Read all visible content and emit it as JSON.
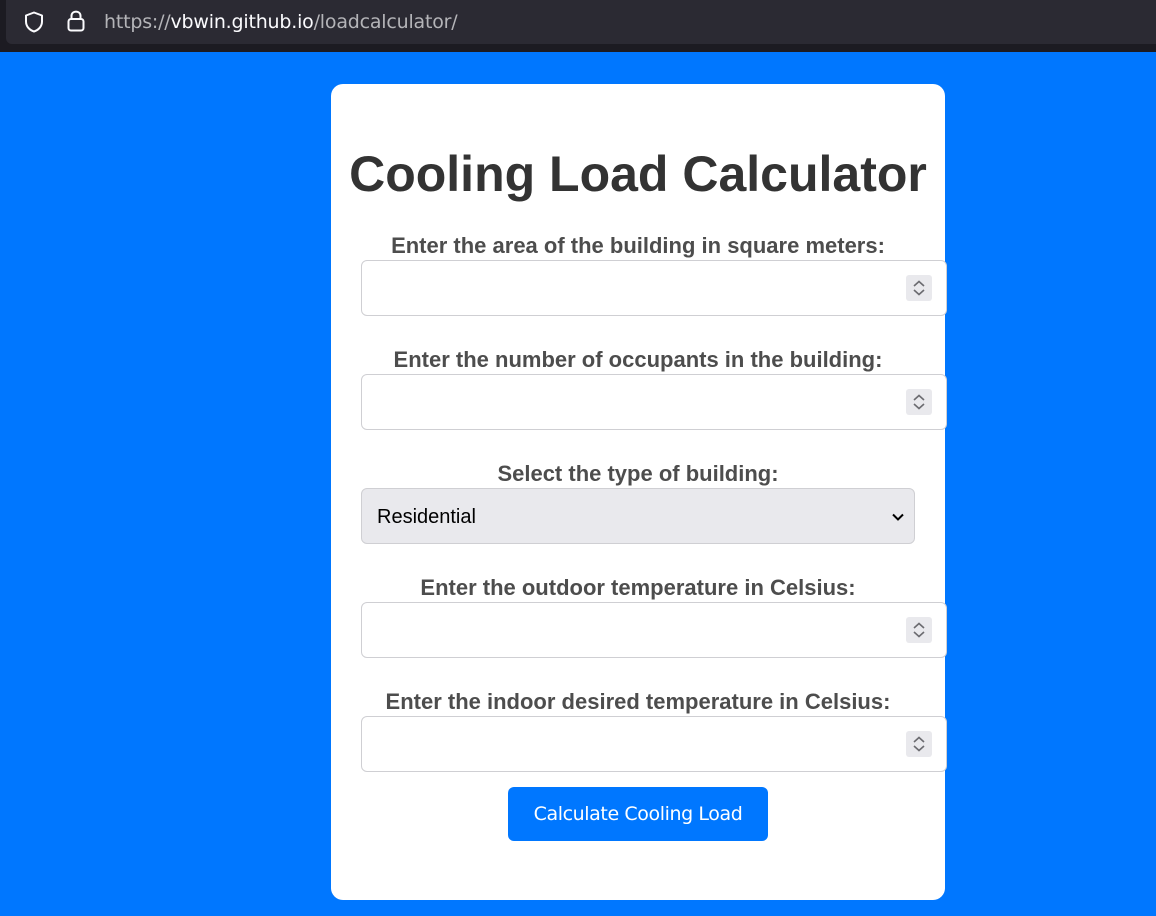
{
  "browser": {
    "url_scheme": "https://",
    "url_host": "vbwin.github.io",
    "url_path": "/loadcalculator/"
  },
  "page": {
    "title": "Cooling Load Calculator",
    "fields": [
      {
        "label": "Enter the area of the building in square meters:",
        "value": ""
      },
      {
        "label": "Enter the number of occupants in the building:",
        "value": ""
      },
      {
        "label": "Select the type of building:",
        "selected": "Residential"
      },
      {
        "label": "Enter the outdoor temperature in Celsius:",
        "value": ""
      },
      {
        "label": "Enter the indoor desired temperature in Celsius:",
        "value": ""
      }
    ],
    "submit_label": "Calculate Cooling Load"
  },
  "colors": {
    "background": "#0077ff",
    "card": "#ffffff",
    "button": "#0077ff",
    "title_text": "#333333",
    "label_text": "#4d4d4d"
  }
}
